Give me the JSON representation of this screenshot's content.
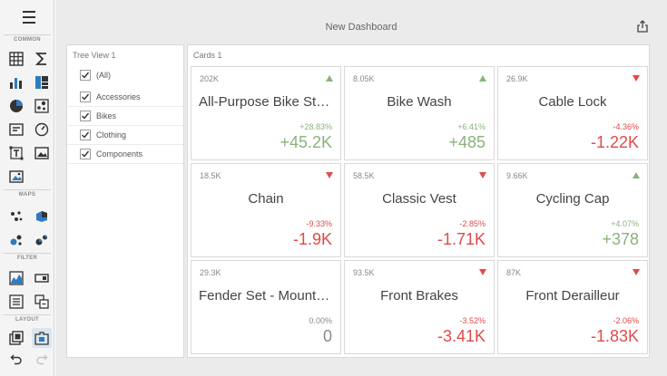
{
  "toolbox": {
    "sections": {
      "common": "COMMON",
      "maps": "MAPS",
      "filter": "FILTER",
      "layout": "LAYOUT"
    }
  },
  "dashboard": {
    "title": "New Dashboard"
  },
  "tree_view": {
    "caption": "Tree View 1",
    "items": [
      {
        "label": "(All)",
        "checked": true
      },
      {
        "label": "Accessories",
        "checked": true
      },
      {
        "label": "Bikes",
        "checked": true
      },
      {
        "label": "Clothing",
        "checked": true
      },
      {
        "label": "Components",
        "checked": true
      }
    ]
  },
  "cards_panel": {
    "caption": "Cards 1",
    "cards": [
      {
        "top": "202K",
        "name": "All-Purpose Bike Stand",
        "trend": "up",
        "pct": "+28.83%",
        "value": "+45.2K",
        "tone": "pos"
      },
      {
        "top": "8.05K",
        "name": "Bike Wash",
        "trend": "up",
        "pct": "+6.41%",
        "value": "+485",
        "tone": "pos"
      },
      {
        "top": "26.9K",
        "name": "Cable Lock",
        "trend": "down",
        "pct": "-4.36%",
        "value": "-1.22K",
        "tone": "neg"
      },
      {
        "top": "18.5K",
        "name": "Chain",
        "trend": "down",
        "pct": "-9.33%",
        "value": "-1.9K",
        "tone": "neg"
      },
      {
        "top": "58.5K",
        "name": "Classic Vest",
        "trend": "down",
        "pct": "-2.85%",
        "value": "-1.71K",
        "tone": "neg"
      },
      {
        "top": "9.66K",
        "name": "Cycling Cap",
        "trend": "up",
        "pct": "+4.07%",
        "value": "+378",
        "tone": "pos"
      },
      {
        "top": "29.3K",
        "name": "Fender Set - Mountain",
        "trend": "none",
        "pct": "0.00%",
        "value": "0",
        "tone": "neu"
      },
      {
        "top": "93.5K",
        "name": "Front Brakes",
        "trend": "down",
        "pct": "-3.52%",
        "value": "-3.41K",
        "tone": "neg"
      },
      {
        "top": "87K",
        "name": "Front Derailleur",
        "trend": "down",
        "pct": "-2.06%",
        "value": "-1.83K",
        "tone": "neg"
      }
    ]
  },
  "colors": {
    "positive": "#8ab27c",
    "negative": "#e04a4a",
    "accent": "#2f7bbf"
  }
}
